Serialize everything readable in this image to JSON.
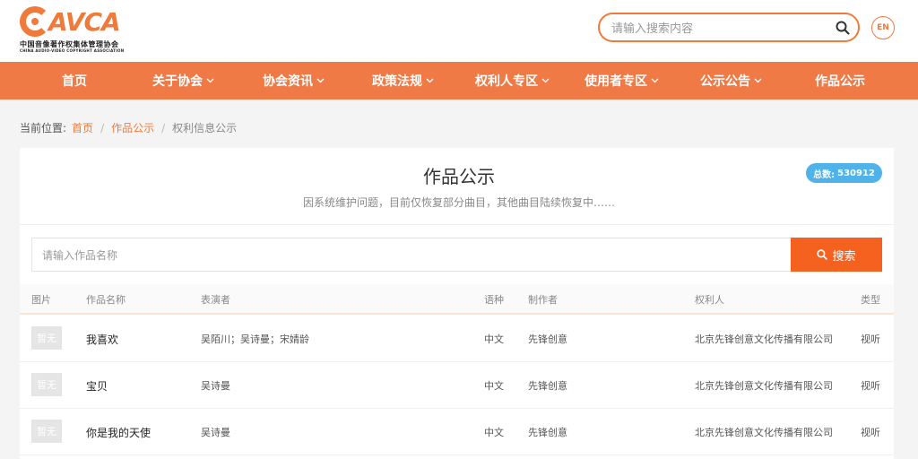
{
  "logo": {
    "letters": "AVCA",
    "cn": "中国音像著作权集体管理协会",
    "en": "CHINA AUDIO-VIDEO COPYRIGHT ASSOCIATION"
  },
  "header": {
    "search_placeholder": "请输入搜索内容",
    "lang_button": "EN"
  },
  "nav": [
    {
      "label": "首页",
      "dropdown": false
    },
    {
      "label": "关于协会",
      "dropdown": true
    },
    {
      "label": "协会资讯",
      "dropdown": true
    },
    {
      "label": "政策法规",
      "dropdown": true
    },
    {
      "label": "权利人专区",
      "dropdown": true
    },
    {
      "label": "使用者专区",
      "dropdown": true
    },
    {
      "label": "公示公告",
      "dropdown": true
    },
    {
      "label": "作品公示",
      "dropdown": false
    }
  ],
  "breadcrumb": {
    "prefix": "当前位置:",
    "home": "首页",
    "section": "作品公示",
    "current": "权利信息公示"
  },
  "page": {
    "title": "作品公示",
    "subtitle": "因系统维护问题，目前仅恢复部分曲目，其他曲目陆续恢复中……",
    "total_label": "总数:",
    "total_value": "530912",
    "search_placeholder": "请输入作品名称",
    "search_button": "搜索"
  },
  "table": {
    "headers": [
      "图片",
      "作品名称",
      "表演者",
      "语种",
      "制作者",
      "权利人",
      "类型"
    ],
    "rows": [
      {
        "thumb": "暂无",
        "name": "我喜欢",
        "performer": "吴陌川；吴诗曼；宋婧龄",
        "language": "中文",
        "producer": "先锋创意",
        "owner": "北京先锋创意文化传播有限公司",
        "type": "视听"
      },
      {
        "thumb": "暂无",
        "name": "宝贝",
        "performer": "吴诗曼",
        "language": "中文",
        "producer": "先锋创意",
        "owner": "北京先锋创意文化传播有限公司",
        "type": "视听"
      },
      {
        "thumb": "暂无",
        "name": "你是我的天使",
        "performer": "吴诗曼",
        "language": "中文",
        "producer": "先锋创意",
        "owner": "北京先锋创意文化传播有限公司",
        "type": "视听"
      }
    ]
  },
  "colors": {
    "brand_orange": "#f07a45",
    "search_button": "#f5611e",
    "total_badge": "#4fb2e8"
  }
}
